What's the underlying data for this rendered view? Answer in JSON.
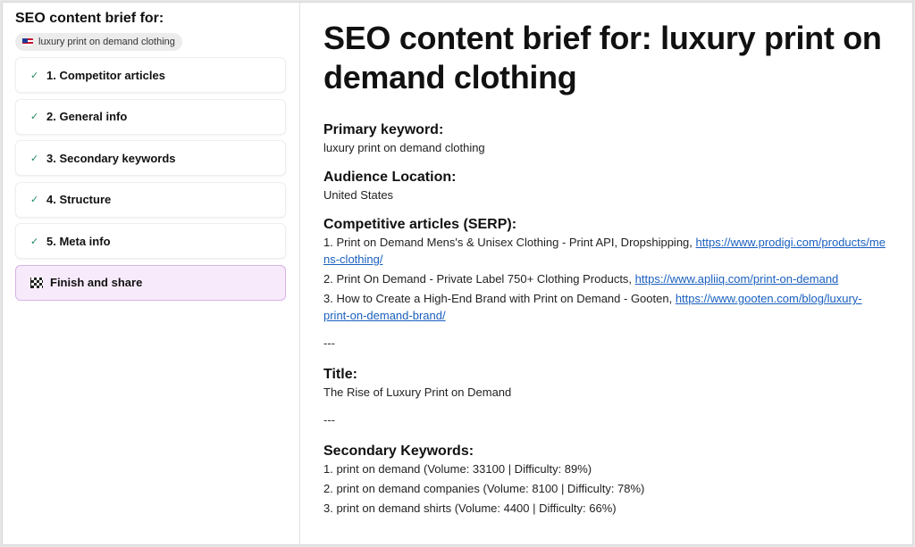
{
  "sidebar": {
    "title": "SEO content brief for:",
    "keyword_chip": "luxury print on demand clothing",
    "chip_icon": "us-flag-icon",
    "steps": [
      {
        "label": "1. Competitor articles",
        "icon": "check-icon",
        "done": true
      },
      {
        "label": "2. General info",
        "icon": "check-icon",
        "done": true
      },
      {
        "label": "3. Secondary keywords",
        "icon": "check-icon",
        "done": true
      },
      {
        "label": "4. Structure",
        "icon": "check-icon",
        "done": true
      },
      {
        "label": "5. Meta info",
        "icon": "check-icon",
        "done": true
      },
      {
        "label": "Finish and share",
        "icon": "checkered-flag-icon",
        "active": true
      }
    ]
  },
  "main": {
    "heading": "SEO content brief for: luxury print on demand clothing",
    "primary_keyword": {
      "label": "Primary keyword:",
      "value": "luxury print on demand clothing"
    },
    "audience_location": {
      "label": "Audience Location:",
      "value": "United States"
    },
    "competitive": {
      "label": "Competitive articles (SERP):",
      "items": [
        {
          "text": "1. Print on Demand Mens's & Unisex Clothing - Print API, Dropshipping, ",
          "link": "https://www.prodigi.com/products/mens-clothing/"
        },
        {
          "text": "2. Print On Demand - Private Label 750+ Clothing Products, ",
          "link": "https://www.apliiq.com/print-on-demand"
        },
        {
          "text": "3. How to Create a High-End Brand with Print on Demand - Gooten, ",
          "link": "https://www.gooten.com/blog/luxury-print-on-demand-brand/"
        }
      ]
    },
    "separator": "---",
    "title": {
      "label": "Title:",
      "value": "The Rise of Luxury Print on Demand"
    },
    "secondary": {
      "label": "Secondary Keywords:",
      "items": [
        "1. print on demand (Volume: 33100 | Difficulty: 89%)",
        "2. print on demand companies (Volume: 8100 | Difficulty: 78%)",
        "3. print on demand shirts (Volume: 4400 | Difficulty: 66%)"
      ]
    }
  },
  "colors": {
    "accent_bg": "#f7ebfb",
    "accent_border": "#d7b3e6",
    "check": "#1f8a5b",
    "link": "#1a5fbf"
  }
}
